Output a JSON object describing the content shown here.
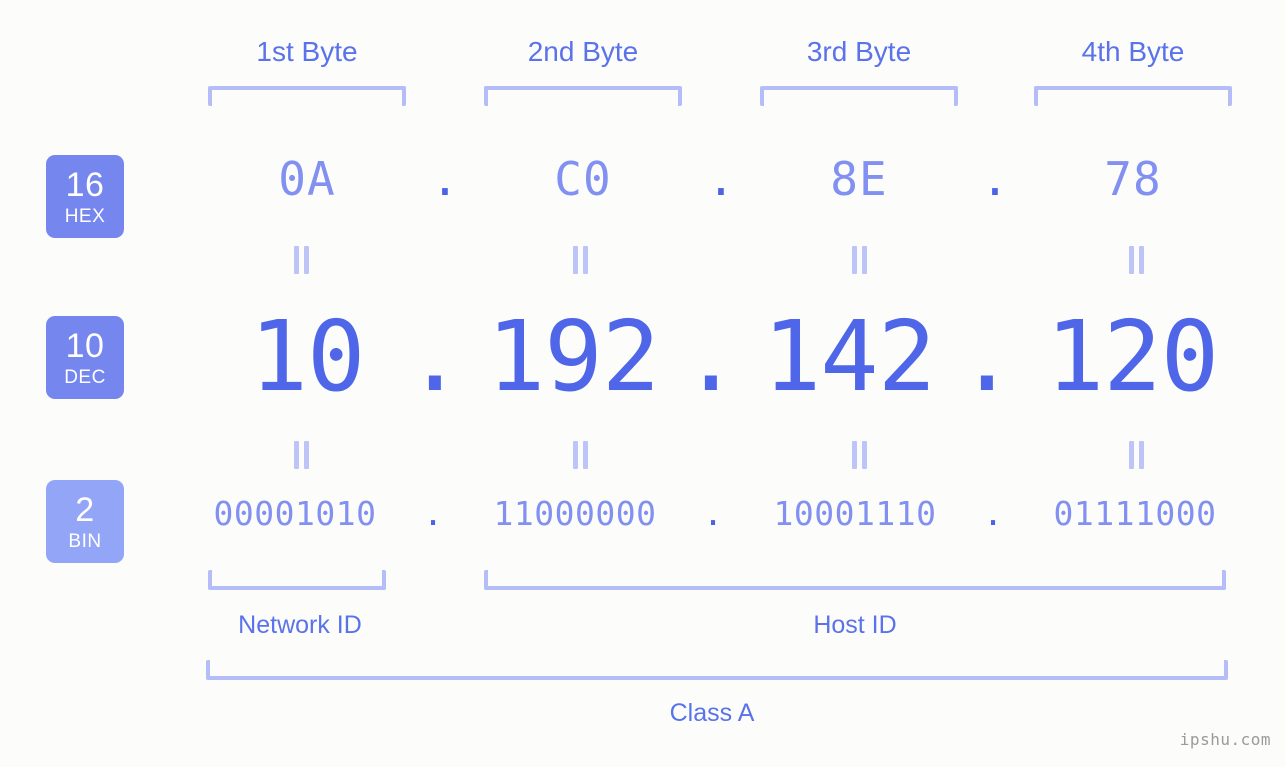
{
  "bytes": [
    {
      "label": "1st Byte"
    },
    {
      "label": "2nd Byte"
    },
    {
      "label": "3rd Byte"
    },
    {
      "label": "4th Byte"
    }
  ],
  "radix_badges": [
    {
      "number": "16",
      "name": "HEX",
      "color": "#7586ef"
    },
    {
      "number": "10",
      "name": "DEC",
      "color": "#7586ef"
    },
    {
      "number": "2",
      "name": "BIN",
      "color": "#93a5f7"
    }
  ],
  "rows": {
    "hex": {
      "octets": [
        "0A",
        "C0",
        "8E",
        "78"
      ],
      "separator": "."
    },
    "dec": {
      "octets": [
        "10",
        "192",
        "142",
        "120"
      ],
      "separator": "."
    },
    "bin": {
      "octets": [
        "00001010",
        "11000000",
        "10001110",
        "01111000"
      ],
      "separator": "."
    }
  },
  "connector": {
    "symbol": "="
  },
  "segments": {
    "network_id": "Network ID",
    "host_id": "Host ID",
    "class": "Class A"
  },
  "watermark": "ipshu.com",
  "colors": {
    "background": "#fcfdfa",
    "bracket": "#b4bdf8",
    "label_blue": "#5a72ea",
    "hex_blue": "#8190f1",
    "dec_blue": "#4f66e8",
    "dot_blue": "#4a63e7",
    "connector": "#bcc4f8",
    "watermark": "#9a9a9a"
  }
}
